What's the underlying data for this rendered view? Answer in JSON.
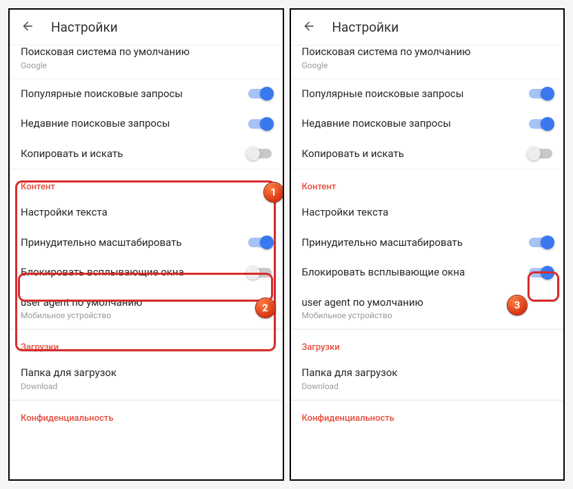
{
  "header": {
    "title": "Настройки"
  },
  "rows": {
    "search_engine": {
      "label": "Поисковая система по умолчанию",
      "sub": "Google"
    },
    "popular": {
      "label": "Популярные поисковые запросы"
    },
    "recent": {
      "label": "Недавние поисковые запросы"
    },
    "copy_search": {
      "label": "Копировать и искать"
    },
    "text_settings": {
      "label": "Настройки текста"
    },
    "force_zoom": {
      "label": "Принудительно масштабировать"
    },
    "block_popups": {
      "label": "Блокировать всплывающие окна"
    },
    "user_agent": {
      "label": "user agent по умолчанию",
      "sub": "Мобильное устройство"
    },
    "download_folder": {
      "label": "Папка для загрузок",
      "sub": "Download"
    }
  },
  "sections": {
    "content": "Контент",
    "downloads": "Загрузки",
    "privacy": "Конфиденциальность"
  },
  "badges": {
    "one": "1",
    "two": "2",
    "three": "3"
  }
}
